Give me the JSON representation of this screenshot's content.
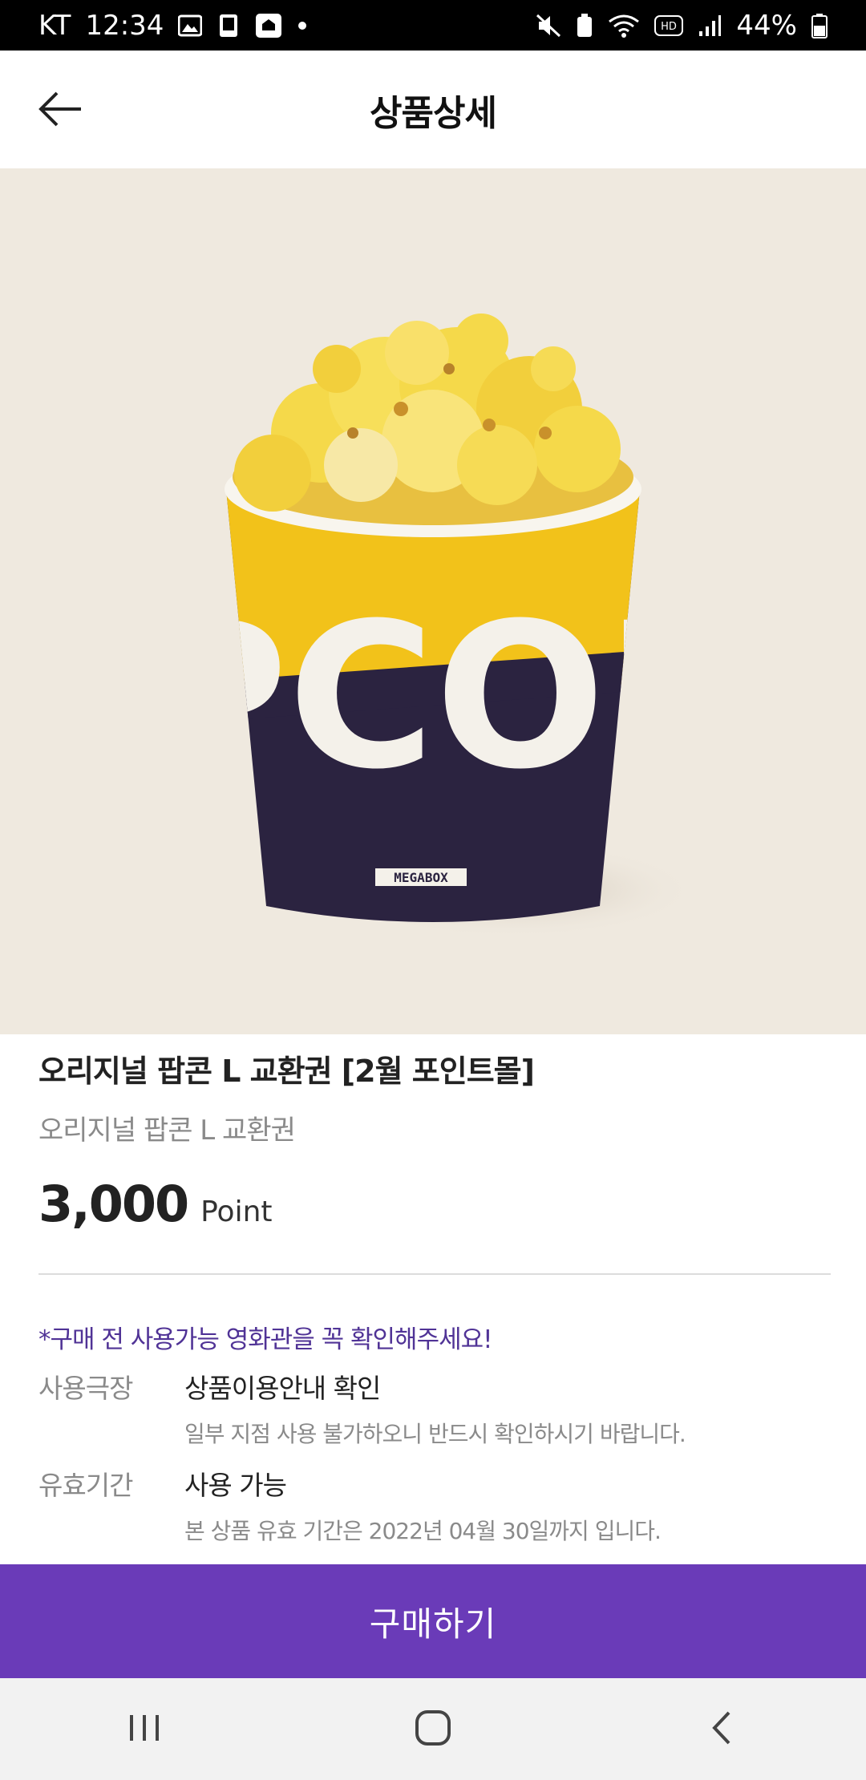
{
  "status_bar": {
    "carrier": "KT",
    "time": "12:34",
    "battery": "44%",
    "icons": [
      "image-icon",
      "phone-icon",
      "home-app-icon",
      "dot-icon",
      "mute-icon",
      "battery-saver-icon",
      "wifi-icon",
      "hd-icon",
      "signal-icon",
      "battery-icon"
    ]
  },
  "header": {
    "title": "상품상세",
    "back_icon": "arrow-left-icon"
  },
  "hero": {
    "cup_text": "OPCORN",
    "brand_label": "MEGABOX",
    "colors": {
      "background": "#efe9df",
      "cup_top": "#f2c21a",
      "cup_bottom": "#2b2340",
      "popcorn": "#f5d94a"
    }
  },
  "product": {
    "name": "오리지널 팝콘 L 교환권 [2월 포인트몰]",
    "subtitle": "오리지널 팝콘 L 교환권",
    "price": "3,000",
    "price_unit": "Point"
  },
  "notice": "*구매 전 사용가능 영화관을 꼭 확인해주세요!",
  "details": [
    {
      "label": "사용극장",
      "value": "상품이용안내 확인",
      "desc": "일부 지점 사용 불가하오니 반드시 확인하시기 바랍니다."
    },
    {
      "label": "유효기간",
      "value": "사용 가능",
      "desc": "본 상품 유효 기간은 2022년 04월 30일까지 입니다."
    }
  ],
  "buy_button": {
    "label": "구매하기",
    "color": "#6a3bb8"
  },
  "nav_bar": {
    "items": [
      "recent-apps-icon",
      "home-icon",
      "back-icon"
    ]
  }
}
